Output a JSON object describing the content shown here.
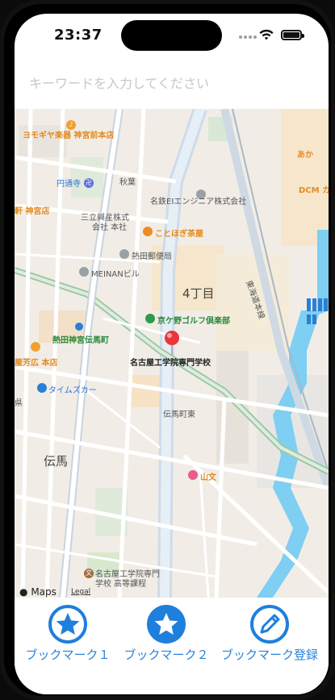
{
  "status_bar": {
    "time": "23:37"
  },
  "search": {
    "placeholder": "キーワードを入力してください"
  },
  "map": {
    "labels": {
      "yomogiya": "ヨモギヤ楽器 神宮前本店",
      "akifune": "秋葉",
      "enzuji": "円通寺",
      "meitetsu": "名鉄EIエンジニア株式会社",
      "keikyu": "軒 神宮店",
      "mitate": "三立興産株式",
      "mitate2": "会社 本社",
      "kotobuki": "ことほぎ茶屋",
      "atsuta_post": "熱田郵便局",
      "meinan": "MEINANビル",
      "yonchome": "4丁目",
      "kyogano": "京ケ野ゴルフ倶楽部",
      "atsuta_station": "熱田神宮伝馬町",
      "yahoshiro": "屋芳広 本店",
      "school": "名古屋工学院専門学校",
      "times": "タイムズカー",
      "denma_east": "伝馬町東",
      "denma": "伝馬",
      "sanbun": "山文",
      "school2_l1": "名古屋工学院専門",
      "school2_l2": "学校 高等課程",
      "dcm": "DCM カ",
      "tokaido": "東海道本線",
      "apple": "Maps",
      "legal": "Legal",
      "ken": "県",
      "aka": "あか"
    }
  },
  "toolbar": {
    "bookmark1": "ブックマーク１",
    "bookmark2": "ブックマーク２",
    "register": "ブックマーク登録"
  },
  "colors": {
    "accent": "#1e7fdc",
    "map_bg": "#f1ede6",
    "road": "#ffffff",
    "highway": "#c9d9e8",
    "water": "#72c7ee"
  }
}
